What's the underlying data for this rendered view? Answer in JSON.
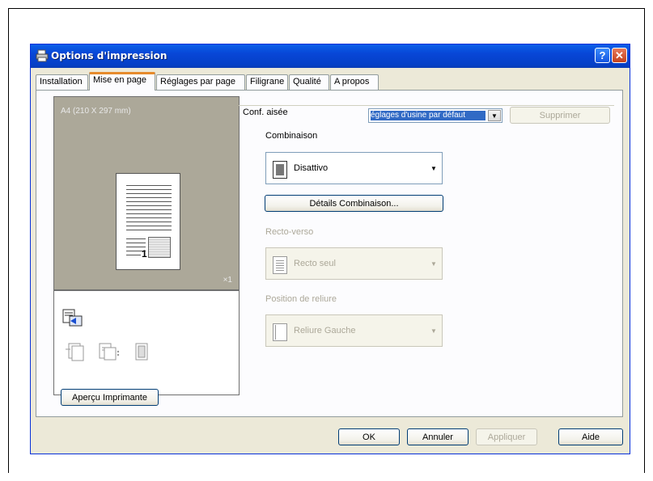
{
  "window": {
    "title": "Options d'impression"
  },
  "tabs": [
    {
      "label": "Installation"
    },
    {
      "label": "Mise en page"
    },
    {
      "label": "Réglages par page"
    },
    {
      "label": "Filigrane"
    },
    {
      "label": "Qualité"
    },
    {
      "label": "A propos"
    }
  ],
  "active_tab": "Mise en page",
  "preview": {
    "paper_label": "A4 (210 X 297 mm)",
    "page_number": "1",
    "copies": "×1",
    "printer_button": "Aperçu Imprimante"
  },
  "easy_set": {
    "label": "Conf. aisée",
    "selected": "églages d'usine par défaut",
    "delete_button": "Supprimer"
  },
  "combination": {
    "label": "Combinaison",
    "value": "Disattivo",
    "details_button": "Détails Combinaison..."
  },
  "duplex": {
    "label": "Recto-verso",
    "value": "Recto seul"
  },
  "binding": {
    "label": "Position de reliure",
    "value": "Reliure Gauche"
  },
  "footer": {
    "ok": "OK",
    "cancel": "Annuler",
    "apply": "Appliquer",
    "help": "Aide"
  }
}
